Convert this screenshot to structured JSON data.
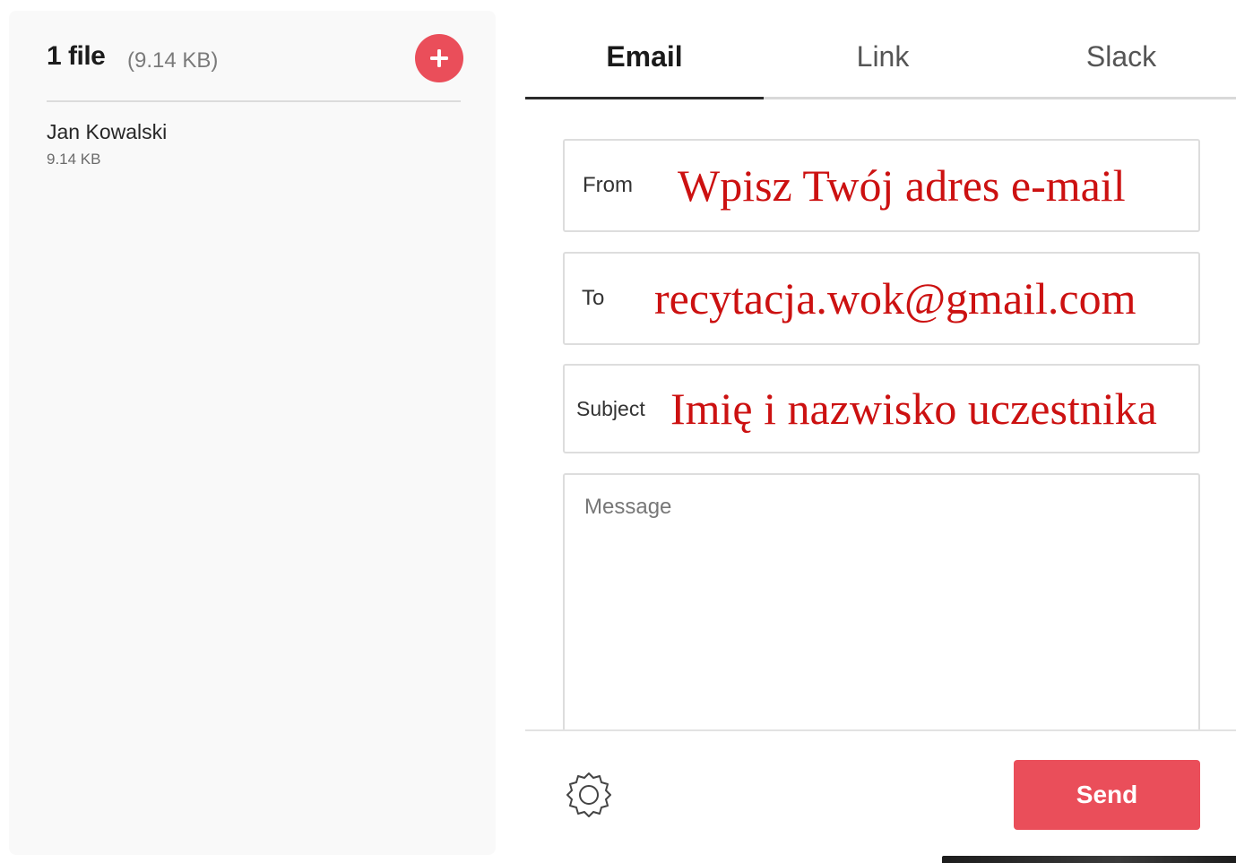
{
  "files": {
    "count_label": "1 file",
    "total_size": "(9.14 KB)",
    "add_icon": "plus-icon",
    "accent_color": "#ea4e5a",
    "items": [
      {
        "name": "Jan Kowalski",
        "size": "9.14 KB"
      }
    ]
  },
  "tabs": [
    {
      "label": "Email",
      "active": true
    },
    {
      "label": "Link",
      "active": false
    },
    {
      "label": "Slack",
      "active": false
    }
  ],
  "form": {
    "from": {
      "label": "From",
      "placeholder": "Wpisz Twój adres e-mail"
    },
    "to": {
      "label": "To",
      "value": "recytacja.wok@gmail.com"
    },
    "subject": {
      "label": "Subject",
      "value": "Imię i nazwisko uczestnika"
    },
    "message": {
      "placeholder": "Message"
    },
    "annotation_color": "#cc1111"
  },
  "footer": {
    "settings_icon": "gear-icon",
    "send_label": "Send"
  }
}
